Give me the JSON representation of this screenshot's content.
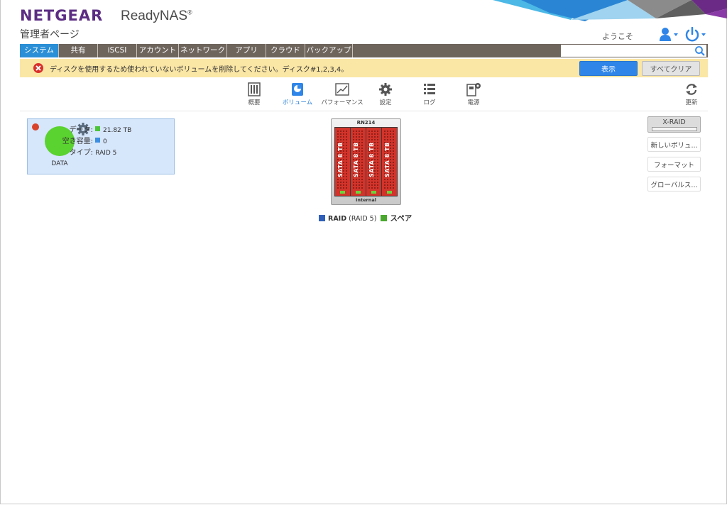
{
  "header": {
    "brand": "NETGEAR",
    "product": "ReadyNAS",
    "product_mark": "®",
    "page_title": "管理者ページ",
    "welcome": "ようこそ",
    "user_icon": "user-icon",
    "power_icon": "power-icon"
  },
  "nav": {
    "tabs": [
      {
        "label": "システム",
        "active": true
      },
      {
        "label": "共有"
      },
      {
        "label": "iSCSI"
      },
      {
        "label": "アカウント"
      },
      {
        "label": "ネットワーク"
      },
      {
        "label": "アプリ"
      },
      {
        "label": "クラウド"
      },
      {
        "label": "バックアップ"
      }
    ],
    "search_value": "",
    "search_icon": "search-icon"
  },
  "alert": {
    "text": "ディスクを使用するため使われていないボリュームを削除してください。ディスク#1,2,3,4。",
    "show_label": "表示",
    "clear_label": "すべてクリア",
    "icon": "error-icon"
  },
  "subtabs": [
    {
      "label": "概要",
      "icon": "overview-icon"
    },
    {
      "label": "ボリューム",
      "icon": "volume-icon",
      "active": true
    },
    {
      "label": "パフォーマンス",
      "icon": "performance-icon"
    },
    {
      "label": "設定",
      "icon": "settings-icon"
    },
    {
      "label": "ログ",
      "icon": "log-icon"
    },
    {
      "label": "電源",
      "icon": "power-settings-icon"
    }
  ],
  "refresh_label": "更新",
  "volume": {
    "name": "DATA",
    "data_key": "データ:",
    "data_value": "21.82 TB",
    "free_key": "空き容量:",
    "free_value": "0",
    "type_key": "タイプ:",
    "type_value": "RAID 5",
    "status_color": "#d9432b",
    "data_color": "#4bc43a",
    "free_color": "#3b8ee0"
  },
  "chassis": {
    "model": "RN214",
    "footer": "Internal",
    "bays": [
      {
        "label": "SATA 8 TB"
      },
      {
        "label": "SATA 8 TB"
      },
      {
        "label": "SATA 8 TB"
      },
      {
        "label": "SATA 8 TB"
      }
    ]
  },
  "legend": {
    "raid_label": "RAID",
    "raid_detail": "(RAID 5)",
    "spare_label": "スペア",
    "raid_color": "#2f5fb8",
    "spare_color": "#4aa82f"
  },
  "side_buttons": {
    "xraid": "X-RAID",
    "new_volume": "新しいボリュ...",
    "format": "フォーマット",
    "global": "グローバルス..."
  }
}
